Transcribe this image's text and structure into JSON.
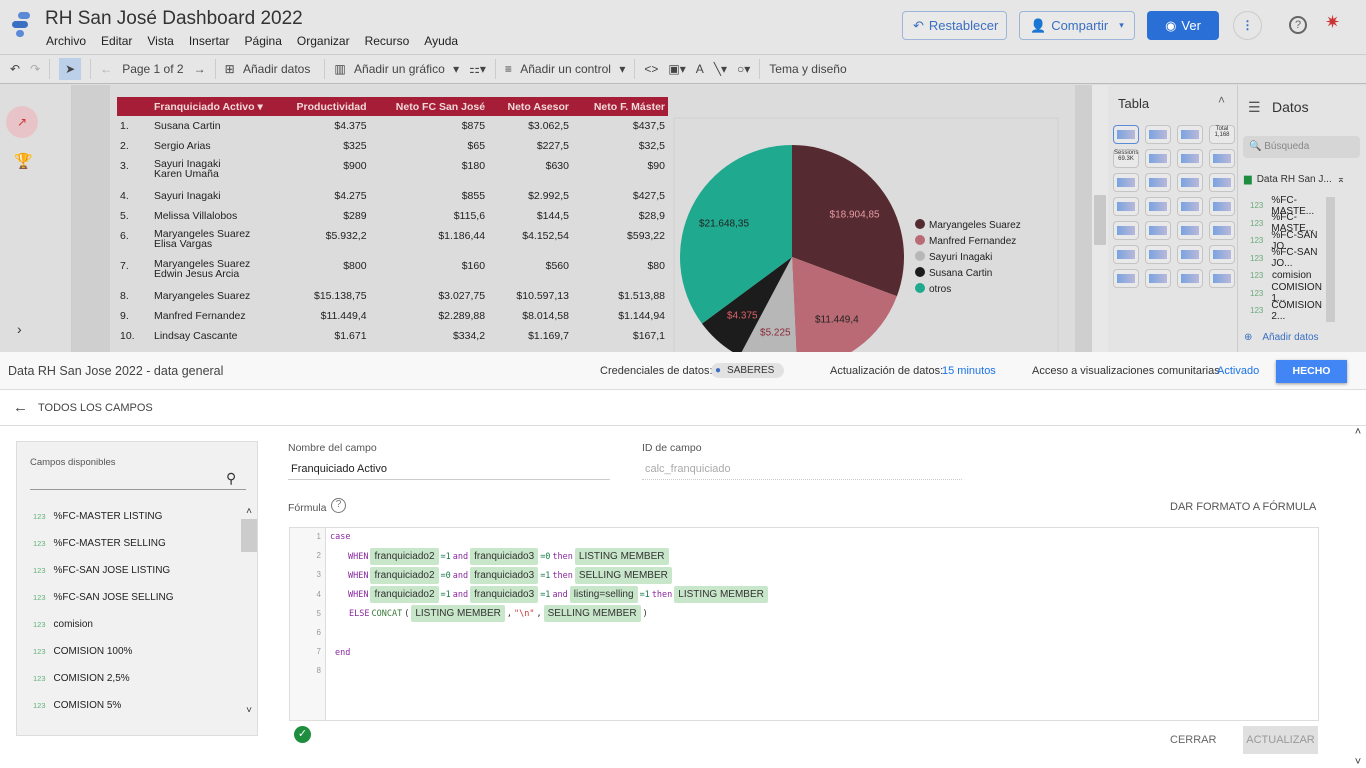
{
  "header": {
    "title": "RH San José Dashboard 2022",
    "menus": [
      "Archivo",
      "Editar",
      "Vista",
      "Insertar",
      "Página",
      "Organizar",
      "Recurso",
      "Ayuda"
    ],
    "reset": "Restablecer",
    "share": "Compartir",
    "view": "Ver"
  },
  "toolbar": {
    "page": "Page 1 of 2",
    "add_data": "Añadir datos",
    "add_chart": "Añadir un gráfico",
    "add_control": "Añadir un control",
    "theme": "Tema y diseño"
  },
  "table": {
    "columns": [
      "Franquiciado Activo",
      "Productividad",
      "Neto FC San José",
      "Neto Asesor",
      "Neto F. Máster"
    ],
    "rows": [
      [
        "1.",
        "Susana Cartin",
        "$4.375",
        "$875",
        "$3.062,5",
        "$437,5"
      ],
      [
        "2.",
        "Sergio Arias",
        "$325",
        "$65",
        "$227,5",
        "$32,5"
      ],
      [
        "3.",
        "Sayuri Inagaki\nKaren Umaña",
        "$900",
        "$180",
        "$630",
        "$90"
      ],
      [
        "4.",
        "Sayuri Inagaki",
        "$4.275",
        "$855",
        "$2.992,5",
        "$427,5"
      ],
      [
        "5.",
        "Melissa Villalobos",
        "$289",
        "$115,6",
        "$144,5",
        "$28,9"
      ],
      [
        "6.",
        "Maryangeles Suarez\nElisa Vargas",
        "$5.932,2",
        "$1.186,44",
        "$4.152,54",
        "$593,22"
      ],
      [
        "7.",
        "Maryangeles Suarez\nEdwin Jesus Arcia",
        "$800",
        "$160",
        "$560",
        "$80"
      ],
      [
        "8.",
        "Maryangeles Suarez",
        "$15.138,75",
        "$3.027,75",
        "$10.597,13",
        "$1.513,88"
      ],
      [
        "9.",
        "Manfred Fernandez",
        "$11.449,4",
        "$2.289,88",
        "$8.014,58",
        "$1.144,94"
      ],
      [
        "10.",
        "Lindsay Cascante",
        "$1.671",
        "$334,2",
        "$1.169,7",
        "$167,1"
      ]
    ]
  },
  "chart_data": {
    "type": "pie",
    "slices": [
      {
        "name": "Maryangeles Suarez",
        "value": 18904.85,
        "label": "$18.904,85",
        "color": "#552a30"
      },
      {
        "name": "Manfred Fernandez",
        "value": 11449.4,
        "label": "$11.449,4",
        "color": "#b96a74"
      },
      {
        "name": "Sayuri Inagaki",
        "value": 5225,
        "label": "$5.225",
        "color": "#b7b7b7"
      },
      {
        "name": "Susana Cartin",
        "value": 4375,
        "label": "$4.375",
        "color": "#1c1c1c"
      },
      {
        "name": "otros",
        "value": 21648.35,
        "label": "$21.648,35",
        "color": "#1fa98f"
      }
    ],
    "legend": "right"
  },
  "tabla_panel": {
    "title": "Tabla",
    "chart_types": [
      "Total 1,168",
      "Sessions 69.3K"
    ]
  },
  "datos_panel": {
    "title": "Datos",
    "search_placeholder": "Búsqueda",
    "source": "Data RH San J...",
    "fields": [
      "%FC-MASTE...",
      "%FC-MASTE...",
      "%FC-SAN JO...",
      "%FC-SAN JO...",
      "comision",
      "COMISION 1...",
      "COMISION 2..."
    ],
    "add": "Añadir datos"
  },
  "editor": {
    "source_name": "Data RH San Jose 2022 - data general",
    "cred_label": "Credenciales de datos:",
    "cred_value": "SABERES",
    "refresh_label": "Actualización de datos:",
    "refresh_value": "15 minutos",
    "community_label": "Acceso a visualizaciones comunitarias",
    "community_value": "Activado",
    "done": "HECHO",
    "back": "TODOS LOS CAMPOS",
    "available_label": "Campos disponibles",
    "available_fields": [
      "%FC-MASTER LISTING",
      "%FC-MASTER SELLING",
      "%FC-SAN JOSE LISTING",
      "%FC-SAN JOSE SELLING",
      "comision",
      "COMISION 100%",
      "COMISION 2,5%",
      "COMISION 5%"
    ],
    "type_tag": "123",
    "field_name_label": "Nombre del campo",
    "field_name": "Franquiciado Activo",
    "field_id_label": "ID de campo",
    "field_id": "calc_franquiciado",
    "formula_label": "Fórmula",
    "format_formula": "DAR FORMATO A FÓRMULA",
    "close": "CERRAR",
    "update": "ACTUALIZAR"
  }
}
